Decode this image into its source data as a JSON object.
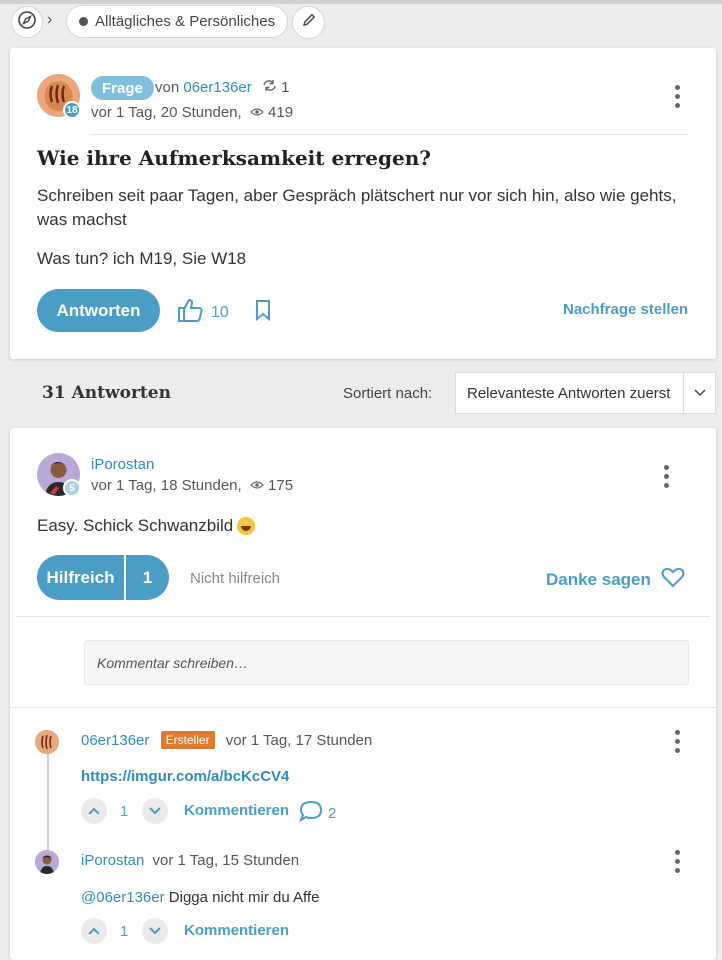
{
  "breadcrumb": {
    "category": "Alltägliches & Persönliches"
  },
  "question": {
    "tag": "Frage",
    "by_prefix": "von",
    "author": "06er136er",
    "author_level": "18",
    "revisions": "1",
    "time": "vor 1 Tag, 20 Stunden,",
    "views": "419",
    "title": "Wie ihre Aufmerksamkeit erregen?",
    "body_1": "Schreiben seit paar Tagen, aber Gespräch plätschert nur vor sich hin, also wie gehts, was machst",
    "body_2": "Was tun? ich M19, Sie W18",
    "answer_button": "Antworten",
    "likes": "10",
    "followup_link": "Nachfrage stellen"
  },
  "answers_header": {
    "count_label": "31 Antworten",
    "sort_label": "Sortiert nach:",
    "sort_value": "Relevanteste Antworten zuerst"
  },
  "answer": {
    "author": "iPorostan",
    "author_level": "5",
    "time": "vor 1 Tag, 18 Stunden,",
    "views": "175",
    "text": "Easy. Schick Schwanzbild",
    "helpful_label": "Hilfreich",
    "helpful_count": "1",
    "not_helpful_label": "Nicht hilfreich",
    "thanks_label": "Danke sagen",
    "comment_placeholder": "Kommentar schreiben…"
  },
  "comments": [
    {
      "author": "06er136er",
      "badge": "Ersteller",
      "time": "vor 1 Tag, 17 Stunden",
      "text": "https://imgur.com/a/bcKcCV4",
      "votes": "1",
      "reply_label": "Kommentieren",
      "replies": "2"
    },
    {
      "author": "iPorostan",
      "time": "vor 1 Tag, 15 Stunden",
      "mention": "@06er136er",
      "text": "Digga nicht mir du Affe",
      "votes": "1",
      "reply_label": "Kommentieren"
    }
  ],
  "colors": {
    "accent": "#4a9ec5",
    "author_badge": "#e07a2f",
    "tag": "#7fc0de"
  }
}
